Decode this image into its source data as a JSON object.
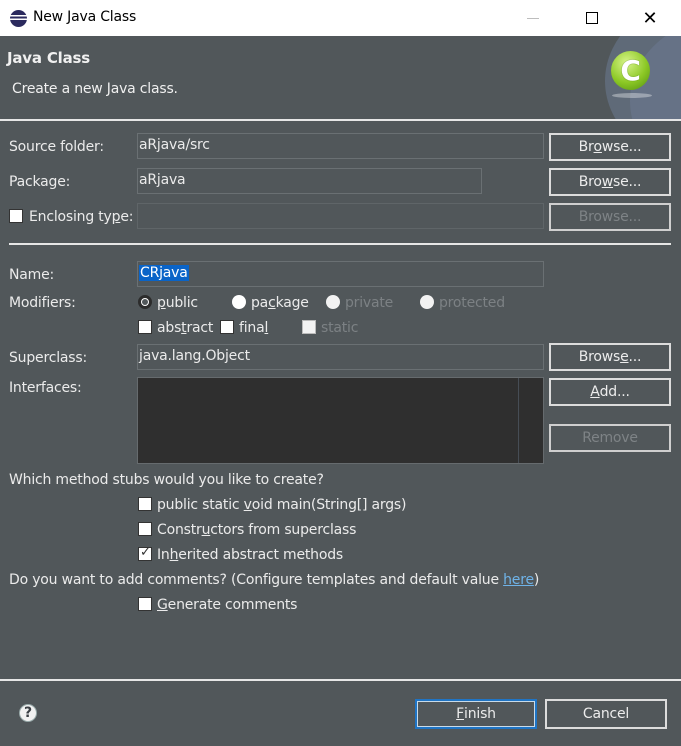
{
  "window": {
    "title": "New Java Class",
    "controls": {
      "minimize": "minimize-icon",
      "maximize": "maximize-icon",
      "close": "close-icon"
    }
  },
  "header": {
    "title": "Java Class",
    "description": "Create a new Java class.",
    "badge_letter": "C"
  },
  "form": {
    "source_folder": {
      "label": "Source folder:",
      "value": "aRjava/src",
      "browse": {
        "pre": "Br",
        "mnemonic": "o",
        "post": "wse..."
      }
    },
    "package": {
      "label": "Package:",
      "value": "aRjava",
      "browse": {
        "pre": "Bro",
        "mnemonic": "w",
        "post": "se..."
      }
    },
    "enclosing_type": {
      "label_pre": "Enclosing ty",
      "label_mnemonic": "p",
      "label_post": "e:",
      "value": "",
      "checked": false,
      "browse": {
        "label": "Browse..."
      }
    },
    "name": {
      "label": "Name:",
      "value": "CRjava"
    },
    "modifiers": {
      "label": "Modifiers:",
      "access": [
        {
          "pre": "",
          "mnemonic": "p",
          "post": "ublic",
          "selected": true,
          "enabled": true
        },
        {
          "pre": "pa",
          "mnemonic": "c",
          "post": "kage",
          "selected": false,
          "enabled": true
        },
        {
          "label": "private",
          "selected": false,
          "enabled": false
        },
        {
          "label": "protected",
          "selected": false,
          "enabled": false
        }
      ],
      "flags": [
        {
          "pre": "abs",
          "mnemonic": "t",
          "post": "ract",
          "checked": false,
          "enabled": true
        },
        {
          "pre": "fina",
          "mnemonic": "l",
          "post": "",
          "checked": false,
          "enabled": true
        },
        {
          "label": "static",
          "checked": false,
          "enabled": false
        }
      ]
    },
    "superclass": {
      "label": "Superclass:",
      "value": "java.lang.Object",
      "browse": {
        "pre": "Brows",
        "mnemonic": "e",
        "post": "..."
      }
    },
    "interfaces": {
      "label": "Interfaces:",
      "items": [],
      "add": {
        "pre": "",
        "mnemonic": "A",
        "post": "dd..."
      },
      "remove": "Remove"
    },
    "stubs": {
      "question": "Which method stubs would you like to create?",
      "options": [
        {
          "pre": "public static ",
          "mnemonic": "v",
          "post": "oid main(String[] args)",
          "checked": false
        },
        {
          "pre": "Constr",
          "mnemonic": "u",
          "post": "ctors from superclass",
          "checked": false
        },
        {
          "pre": "In",
          "mnemonic": "h",
          "post": "erited abstract methods",
          "checked": true
        }
      ]
    },
    "comments": {
      "question": "Do you want to add comments? (Configure templates and default value ",
      "link": "here",
      "question_end": ")",
      "option": {
        "pre": "",
        "mnemonic": "G",
        "post": "enerate comments",
        "checked": false
      }
    }
  },
  "footer": {
    "help_icon": "help-icon",
    "finish": {
      "mnemonic": "F",
      "post": "inish"
    },
    "cancel": "Cancel"
  },
  "colors": {
    "background": "#51575a",
    "link": "#6fb3e8",
    "selection": "#0a64c8",
    "primary_border": "#1f74c4"
  }
}
